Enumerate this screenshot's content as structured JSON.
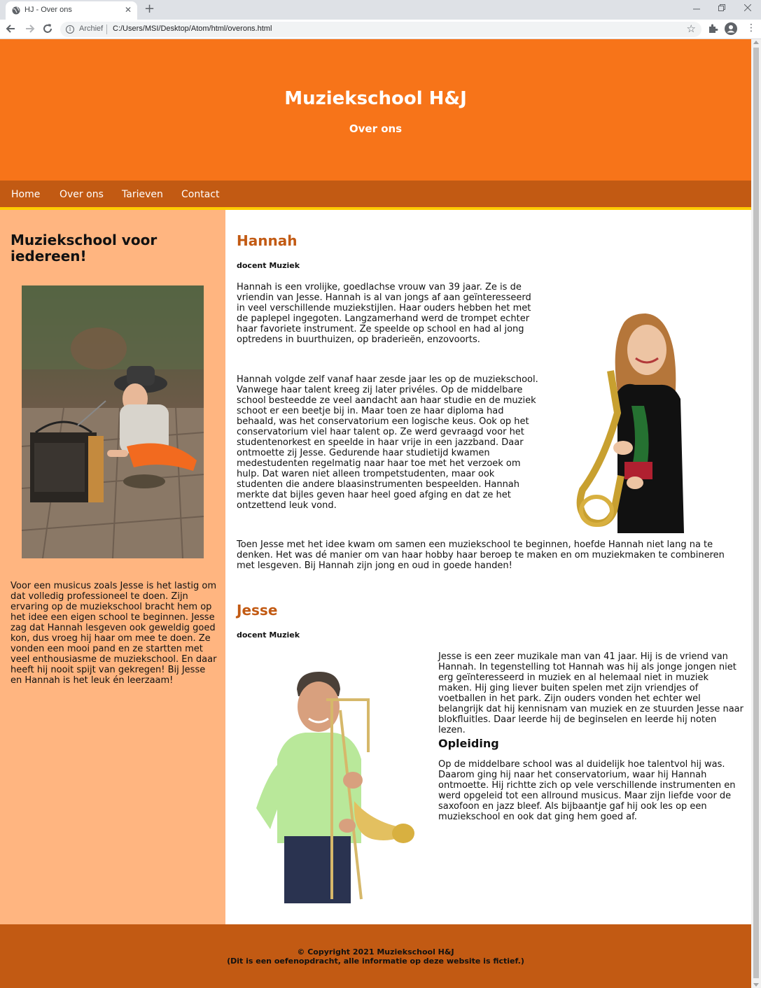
{
  "browser": {
    "tab_title": "HJ - Over ons",
    "tab_close": "✕",
    "new_tab": "+",
    "omnibox_badge": "Archief",
    "url": "C:/Users/MSI/Desktop/Atom/html/overons.html",
    "icons": [
      "globe-icon",
      "close-icon",
      "plus-icon",
      "minimize-icon",
      "restore-icon",
      "back-icon",
      "forward-icon",
      "reload-icon",
      "info-icon",
      "star-icon",
      "extensions-icon",
      "profile-icon",
      "menu-icon"
    ]
  },
  "header": {
    "title": "Muziekschool H&J",
    "subtitle": "Over ons"
  },
  "nav": {
    "items": [
      "Home",
      "Over ons",
      "Tarieven",
      "Contact"
    ]
  },
  "sidebar": {
    "title": "Muziekschool voor iedereen!",
    "text": "Voor een musicus zoals Jesse is het lastig om dat volledig professioneel te doen. Zijn ervaring op de muziekschool bracht hem op het idee een eigen school te beginnen. Jesse zag dat Hannah lesgeven ook geweldig goed kon, dus vroeg hij haar om mee te doen. Ze vonden een mooi pand en ze startten met veel enthousiasme de muziekschool. En daar heeft hij nooit spijt van gekregen! Bij Jesse en Hannah is het leuk én leerzaam!"
  },
  "hannah": {
    "name": "Hannah",
    "role": "docent Muziek",
    "p1": "Hannah is een vrolijke, goedlachse vrouw van 39 jaar. Ze is de vriendin van Jesse. Hannah is al van jongs af aan geïnteresseerd in veel verschillende muziekstijlen. Haar ouders hebben het met de paplepel ingegoten. Langzamerhand werd de trompet echter haar favoriete instrument. Ze speelde op school en had al jong optredens in buurthuizen, op braderieën, enzovoorts.",
    "p2": "Hannah volgde zelf vanaf haar zesde jaar les op de muziekschool. Vanwege haar talent kreeg zij later privéles. Op de middelbare school besteedde ze veel aandacht aan haar studie en de muziek schoot er een beetje bij in. Maar toen ze haar diploma had behaald, was het conservatorium een logische keus. Ook op het conservatorium viel haar talent op. Ze werd gevraagd voor het studentenorkest en speelde in haar vrije in een jazzband. Daar ontmoette zij Jesse. Gedurende haar studietijd kwamen medestudenten regelmatig naar haar toe met het verzoek om hulp. Dat waren niet alleen trompetstudenten, maar ook studenten die andere blaasinstrumenten bespeelden. Hannah merkte dat bijles geven haar heel goed afging en dat ze het ontzettend leuk vond.",
    "p3": "Toen Jesse met het idee kwam om samen een muziekschool te beginnen, hoefde Hannah niet lang na te denken. Het was dé manier om van haar hobby haar beroep te maken en om muziekmaken te combineren met lesgeven. Bij Hannah zijn jong en oud in goede handen!"
  },
  "jesse": {
    "name": "Jesse",
    "role": "docent Muziek",
    "p1": "Jesse is een zeer muzikale man van 41 jaar. Hij is de vriend van Hannah. In tegenstelling tot Hannah was hij als jonge jongen niet erg geïnteresseerd in muziek en al helemaal niet in muziek maken. Hij ging liever buiten spelen met zijn vriendjes of voetballen in het park. Zijn ouders vonden het echter wel belangrijk dat hij kennisnam van muziek en ze stuurden Jesse naar blokfluitles. Daar leerde hij de beginselen en leerde hij noten lezen.",
    "subheading": "Opleiding",
    "p2": "Op de middelbare school was al duidelijk hoe talentvol hij was. Daarom ging hij naar het conservatorium, waar hij Hannah ontmoette. Hij richtte zich op vele verschillende instrumenten en werd opgeleid tot een allround musicus. Maar zijn liefde voor de saxofoon en jazz bleef. Als bijbaantje gaf hij ook les op een muziekschool en ook dat ging hem goed af."
  },
  "footer": {
    "line1": "© Copyright 2021 Muziekschool H&J",
    "line2": "(Dit is een oefenopdracht, alle informatie op deze website is fictief.)"
  },
  "colors": {
    "header": "#f77419",
    "nav": "#c25a13",
    "nav_border": "#ffcc00",
    "sidebar": "#ffb580",
    "accent": "#c25a13",
    "footer": "#c25a13"
  }
}
